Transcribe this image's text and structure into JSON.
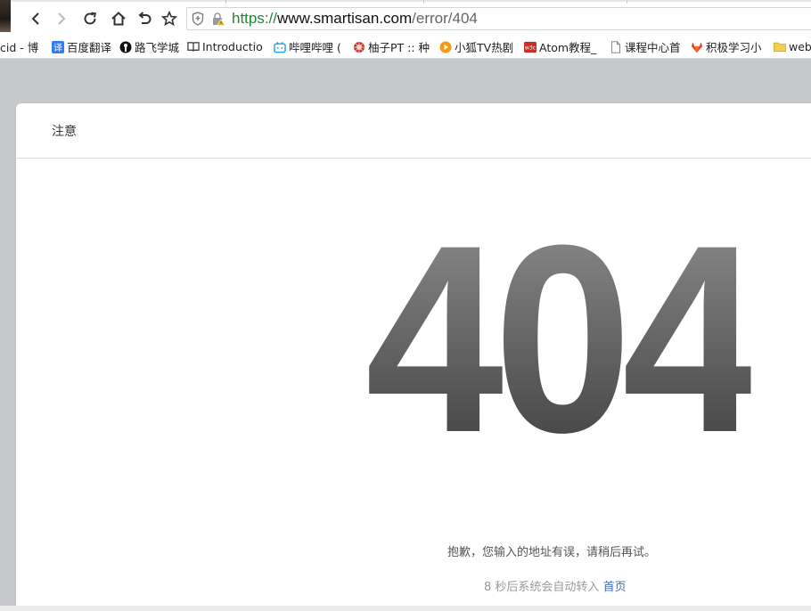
{
  "browser": {
    "url_scheme": "https://",
    "url_host": "www.smartisan.com",
    "url_path": "/error/404"
  },
  "bookmarks": [
    {
      "label": "cid - 博",
      "icon": "none"
    },
    {
      "label": "百度翻译",
      "icon": "baidu-translate-icon"
    },
    {
      "label": "路飞学城",
      "icon": "luffy-icon"
    },
    {
      "label": "Introductio",
      "icon": "book-icon"
    },
    {
      "label": "哔哩哔哩 (",
      "icon": "bilibili-icon"
    },
    {
      "label": "柚子PT :: 种",
      "icon": "pt-icon"
    },
    {
      "label": "小狐TV热剧",
      "icon": "play-icon"
    },
    {
      "label": "Atom教程_",
      "icon": "w3c-icon"
    },
    {
      "label": "课程中心首",
      "icon": "page-icon"
    },
    {
      "label": "积极学习小",
      "icon": "gitlab-icon"
    },
    {
      "label": "web",
      "icon": "folder-icon"
    }
  ],
  "page": {
    "header_title": "注意",
    "error_code": "404",
    "sorry_text": "抱歉，您输入的地址有误，请稍后再试。",
    "redirect_seconds": "8",
    "redirect_text": "秒后系统会自动转入",
    "home_link": "首页"
  },
  "colors": {
    "url_scheme": "#1a8a2f",
    "link": "#3f6fb8",
    "page_bg": "#c7c8cb"
  }
}
